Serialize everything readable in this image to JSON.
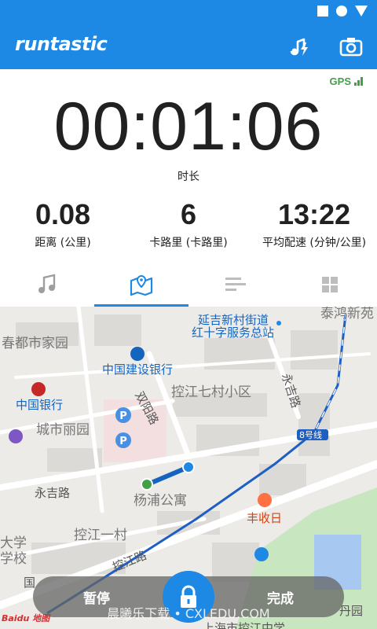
{
  "app": {
    "brand": "runtastic"
  },
  "gps": {
    "label": "GPS"
  },
  "timer": {
    "value": "00:01:06",
    "label": "时长"
  },
  "stats": [
    {
      "value": "0.08",
      "label": "距离 (公里)"
    },
    {
      "value": "6",
      "label": "卡路里 (卡路里)"
    },
    {
      "value": "13:22",
      "label": "平均配速 (分钟/公里)"
    }
  ],
  "tabs": [
    {
      "icon": "music-note-icon"
    },
    {
      "icon": "map-icon",
      "active": true
    },
    {
      "icon": "bar-list-icon"
    },
    {
      "icon": "grid-icon"
    }
  ],
  "map": {
    "labels": [
      "延吉新村街道",
      "红十字服务总站",
      "泰鸿新苑",
      "春都市家园",
      "中国建设银行",
      "控江七村小区",
      "双阳路",
      "永吉路",
      "中国银行",
      "城市丽园",
      "8号线",
      "永吉路",
      "杨浦公寓",
      "丰收日",
      "控江一村",
      "大学",
      "学校",
      "控江路",
      "国",
      "丹园",
      "上海市控江中学"
    ]
  },
  "controls": {
    "pause": "暂停",
    "finish": "完成"
  },
  "watermark": "晨曦乐下载 • CXLEDU.COM",
  "baidu": "Baidu 地图",
  "colors": {
    "primary": "#1e88e5",
    "gps": "#43a047",
    "route": "#1e5fc4"
  }
}
